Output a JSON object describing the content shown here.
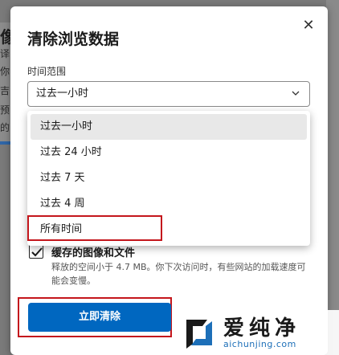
{
  "background": {
    "fragments": [
      "像",
      "译",
      "你",
      "吉",
      "预",
      "的"
    ]
  },
  "dialog": {
    "title": "清除浏览数据",
    "close_icon": "close-icon",
    "time_range_label": "时间范围",
    "selected_range": "过去一小时",
    "options": [
      "过去一小时",
      "过去 24 小时",
      "过去 7 天",
      "过去 4 周",
      "所有时间"
    ],
    "cache": {
      "title": "缓存的图像和文件",
      "description": "释放的空间小于 4.7 MB。你下次访问时，有些网站的加载速度可能会变慢。",
      "checked": true
    },
    "clear_button": "立即清除"
  },
  "watermark": {
    "name": "爱纯净",
    "url": "aichunjing.com"
  },
  "colors": {
    "accent": "#0067c0",
    "highlight_border": "#c4161c"
  }
}
